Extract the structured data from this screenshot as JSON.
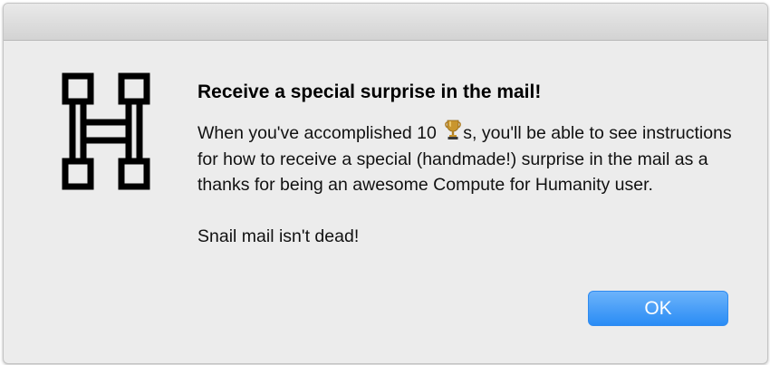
{
  "dialog": {
    "headline": "Receive a special surprise in the mail!",
    "body_part1": "When you've accomplished 10 ",
    "trophy_icon": "trophy-icon",
    "body_part2": "s, you'll be able to see instructions for how to receive a special (handmade!) surprise in the mail as a thanks for being an awesome Compute for Humanity user.",
    "footer_note": "Snail mail isn't dead!",
    "ok_label": "OK",
    "app_icon": "compute-for-humanity-logo-icon"
  },
  "colors": {
    "window_bg": "#ececec",
    "button_top": "#6cb3fa",
    "button_bottom": "#2a8cf5",
    "button_text": "#ffffff"
  }
}
